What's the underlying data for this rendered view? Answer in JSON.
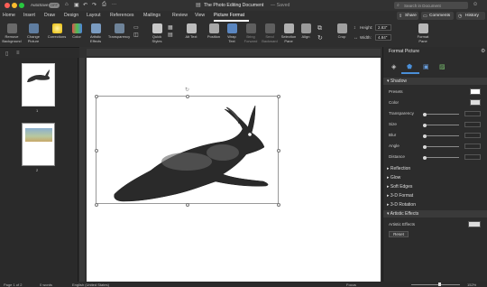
{
  "window": {
    "autosave_label": "AutoSave",
    "autosave_state": "OFF",
    "title": "The Photo Editing Document",
    "saved_status": "— Saved",
    "search_placeholder": "Search in Document"
  },
  "ribbon_tabs": [
    "Home",
    "Insert",
    "Draw",
    "Design",
    "Layout",
    "References",
    "Mailings",
    "Review",
    "View",
    "Picture Format"
  ],
  "active_tab": "Picture Format",
  "top_actions": {
    "share": "Share",
    "comments": "Comments",
    "history": "History"
  },
  "ribbon": {
    "remove_background": "Remove Background",
    "change_picture": "Change Picture",
    "corrections": "Corrections",
    "color": "Color",
    "artistic_effects": "Artistic Effects",
    "transparency": "Transparency",
    "quick_styles": "Quick Styles",
    "alt_text": "Alt Text",
    "position": "Position",
    "wrap_text": "Wrap Text",
    "bring_forward": "Bring Forward",
    "send_backward": "Send Backward",
    "selection_pane": "Selection Pane",
    "align": "Align",
    "crop": "Crop",
    "height_label": "Height:",
    "height_value": "2.83\"",
    "width_label": "Width:",
    "width_value": "4.84\"",
    "format_pane": "Format Pane"
  },
  "thumbnails": {
    "page1_num": "1",
    "page2_num": "2"
  },
  "format_panel": {
    "title": "Format Picture",
    "sections": {
      "shadow": "Shadow",
      "reflection": "Reflection",
      "glow": "Glow",
      "soft_edges": "Soft Edges",
      "format_3d": "3-D Format",
      "rotation_3d": "3-D Rotation",
      "artistic_effects": "Artistic Effects"
    },
    "shadow_rows": {
      "presets": "Presets",
      "color": "Color",
      "transparency": "Transparency",
      "size": "Size",
      "blur": "Blur",
      "angle": "Angle",
      "distance": "Distance"
    },
    "artistic_effects_label": "Artistic Effects",
    "reset_button": "Reset"
  },
  "status": {
    "page": "Page 1 of 2",
    "words": "0 words",
    "language": "English (United States)",
    "focus": "Focus",
    "zoom": "152%"
  },
  "colors": {
    "accent": "#4a8fd8",
    "active_tab": "#ffffff",
    "close": "#ff5f57",
    "minimize": "#febc2e",
    "maximize": "#28c840"
  }
}
